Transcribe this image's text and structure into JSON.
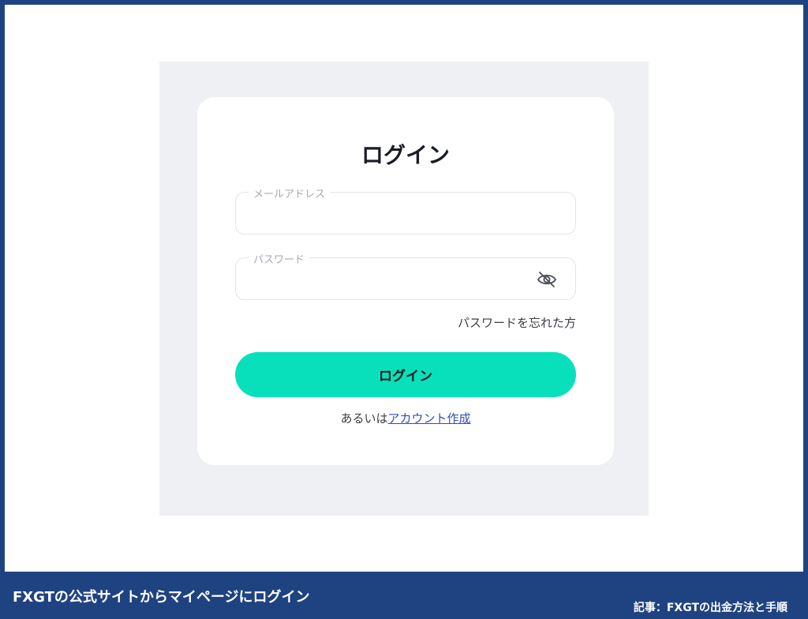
{
  "login_card": {
    "title": "ログイン",
    "email_field": {
      "label": "メールアドレス",
      "value": ""
    },
    "password_field": {
      "label": "パスワード",
      "value": "",
      "toggle_icon": "eye-slash-icon"
    },
    "forgot_password": "パスワードを忘れた方",
    "login_button": "ログイン",
    "signup_prefix": "あるいは",
    "signup_link": "アカウント作成"
  },
  "caption": {
    "left": "FXGTの公式サイトからマイページにログイン",
    "right": "記事：FXGTの出金方法と手順"
  },
  "colors": {
    "frame_border": "#1f4380",
    "panel_background": "#eff0f4",
    "login_button": "#08e0bb",
    "link": "#2d50b4"
  }
}
